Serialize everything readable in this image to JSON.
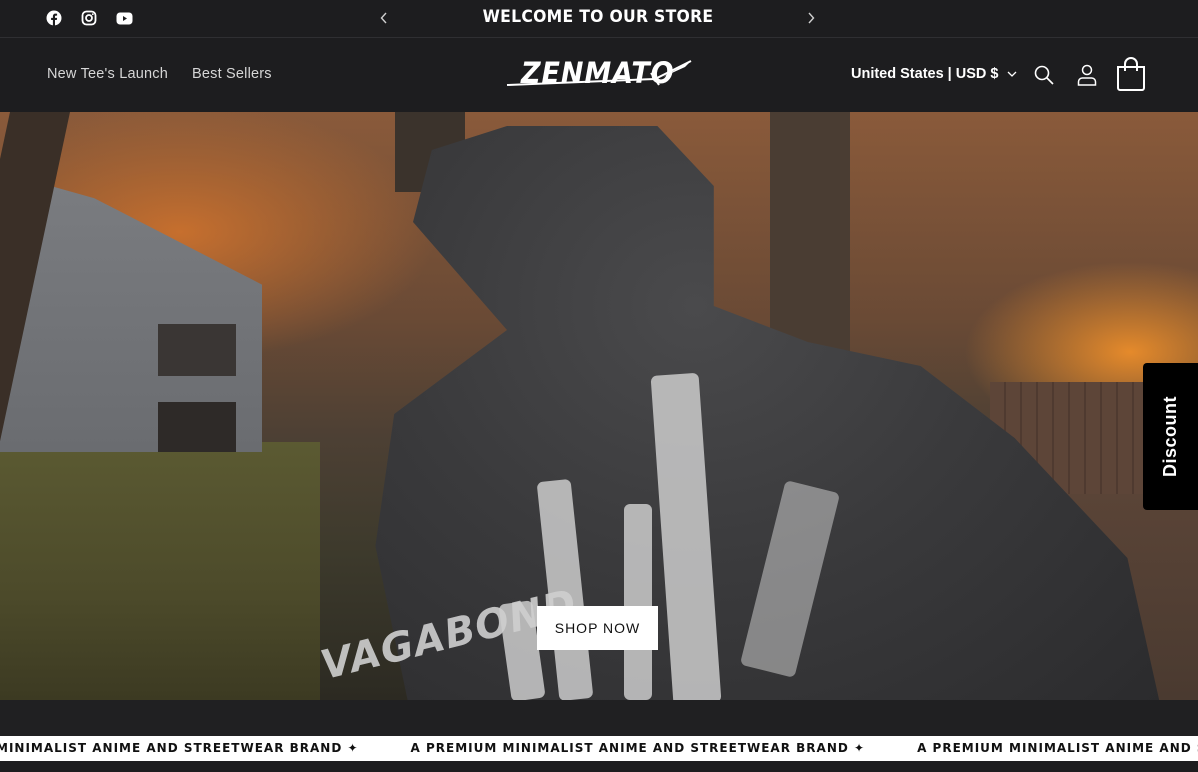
{
  "announcement": {
    "message": "WELCOME TO OUR STORE",
    "social": [
      "facebook-icon",
      "instagram-icon",
      "youtube-icon"
    ]
  },
  "header": {
    "nav": [
      "New Tee's Launch",
      "Best Sellers"
    ],
    "logo_text": "ZENMATO",
    "locale": "United States | USD $",
    "icons": [
      "search-icon",
      "account-icon",
      "cart-icon"
    ]
  },
  "hero": {
    "cta": "SHOP NOW",
    "print_text": "VAGABOND"
  },
  "discount_tab": {
    "label": "Discount"
  },
  "marquee": {
    "items": [
      "MINIMALIST ANIME AND STREETWEAR BRAND ✦",
      "A PREMIUM MINIMALIST ANIME AND STREETWEAR BRAND ✦",
      "A PREMIUM MINIMALIST ANIME AND STREETWEAR BRAND ✦"
    ]
  },
  "colors": {
    "header_bg": "#1d1d1f",
    "button_bg": "#ffffff",
    "discount_bg": "#000000"
  }
}
